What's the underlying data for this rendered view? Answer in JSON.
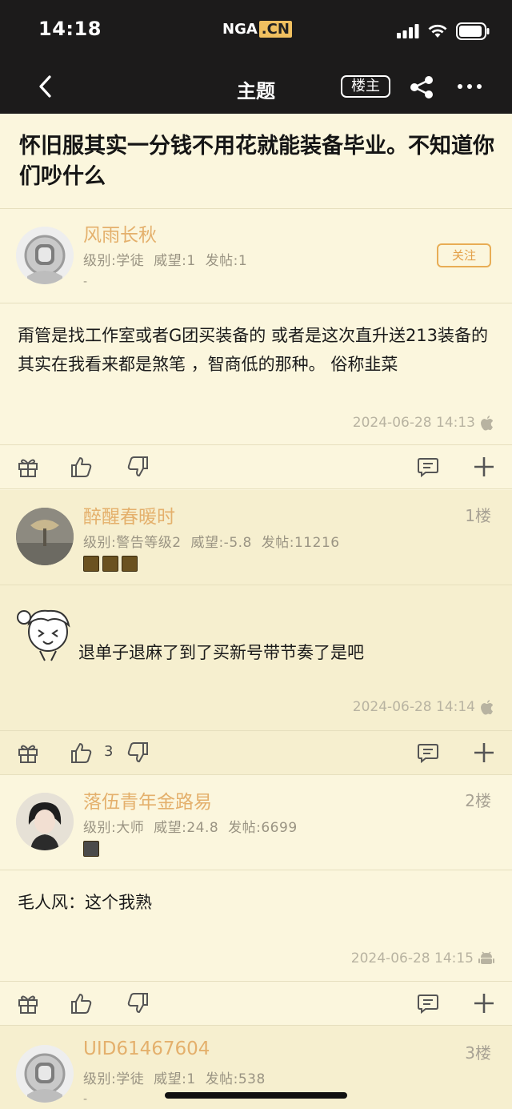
{
  "status_bar": {
    "time": "14:18",
    "logo_text": "NGA",
    "logo_suffix": ".CN"
  },
  "nav": {
    "title": "主题",
    "op_label": "楼主"
  },
  "thread": {
    "title": "怀旧服其实一分钱不用花就能装备毕业。不知道你们吵什么"
  },
  "posts": [
    {
      "username": "风雨长秋",
      "level": "级别:学徒",
      "prestige": "威望:1",
      "post_count": "发帖:1",
      "signature": "-",
      "follow_label": "关注",
      "content": "甭管是找工作室或者G团买装备的 或者是这次直升送213装备的 其实在我看来都是煞笔 ，智商低的那种。 俗称韭菜",
      "timestamp": "2024-06-28 14:13",
      "device_icon": "apple-icon"
    },
    {
      "username": "醉醒春暖时",
      "floor": "1楼",
      "level": "级别:警告等级2",
      "prestige": "威望:-5.8",
      "post_count": "发帖:11216",
      "content": "退单子退麻了到了买新号带节奏了是吧",
      "timestamp": "2024-06-28 14:14",
      "device_icon": "apple-icon",
      "like_count": "3"
    },
    {
      "username": "落伍青年金路易",
      "floor": "2楼",
      "level": "级别:大师",
      "prestige": "威望:24.8",
      "post_count": "发帖:6699",
      "content": "毛人风：这个我熟",
      "timestamp": "2024-06-28 14:15",
      "device_icon": "android-icon"
    },
    {
      "username": "UID61467604",
      "floor": "3楼",
      "level": "级别:学徒",
      "prestige": "威望:1",
      "post_count": "发帖:538",
      "signature": "-"
    }
  ],
  "colors": {
    "background": "#fbf6dd",
    "header": "#1c1b1b",
    "username": "#e4b06c",
    "follow": "#e8ad55"
  }
}
